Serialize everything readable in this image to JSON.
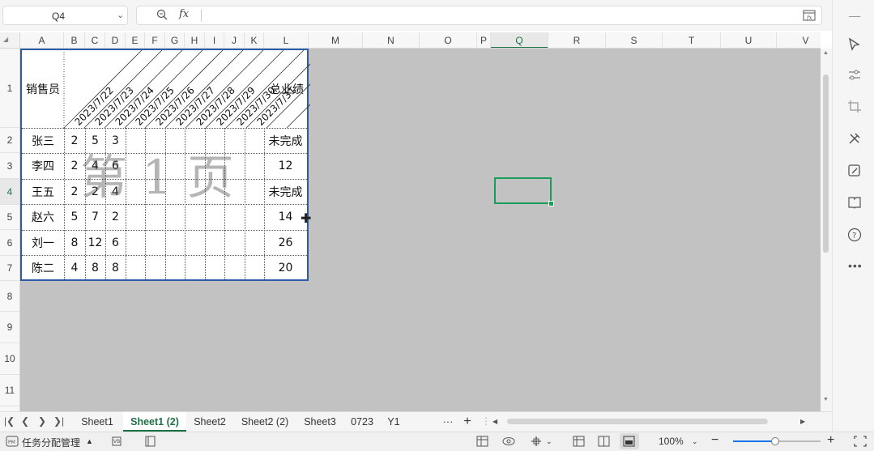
{
  "name_box": {
    "value": "Q4"
  },
  "formula_bar": {
    "fx_label": "fx",
    "value": ""
  },
  "columns": [
    {
      "label": "A"
    },
    {
      "label": "B"
    },
    {
      "label": "C"
    },
    {
      "label": "D"
    },
    {
      "label": "E"
    },
    {
      "label": "F"
    },
    {
      "label": "G"
    },
    {
      "label": "H"
    },
    {
      "label": "I"
    },
    {
      "label": "J"
    },
    {
      "label": "K"
    },
    {
      "label": "L"
    },
    {
      "label": "M"
    },
    {
      "label": "N"
    },
    {
      "label": "O"
    },
    {
      "label": "P"
    },
    {
      "label": "Q"
    },
    {
      "label": "R"
    },
    {
      "label": "S"
    },
    {
      "label": "T"
    },
    {
      "label": "U"
    },
    {
      "label": "V"
    }
  ],
  "rows": [
    "1",
    "2",
    "3",
    "4",
    "5",
    "6",
    "7",
    "8",
    "9",
    "10",
    "11"
  ],
  "selected_column": "Q",
  "selected_row": "4",
  "sheet": {
    "header_label": "销售员",
    "total_header": "总业绩",
    "date_headers": [
      "2023/7/22",
      "2023/7/23",
      "2023/7/24",
      "2023/7/25",
      "2023/7/26",
      "2023/7/27",
      "2023/7/28",
      "2023/7/29",
      "2023/7/30",
      "2023/7/31"
    ],
    "data_rows": [
      {
        "name": "张三",
        "b": "2",
        "c": "5",
        "d": "3",
        "total": "未完成"
      },
      {
        "name": "李四",
        "b": "2",
        "c": "4",
        "d": "6",
        "total": "12"
      },
      {
        "name": "王五",
        "b": "2",
        "c": "2",
        "d": "4",
        "total": "未完成"
      },
      {
        "name": "赵六",
        "b": "5",
        "c": "7",
        "d": "2",
        "total": "14"
      },
      {
        "name": "刘一",
        "b": "8",
        "c": "12",
        "d": "6",
        "total": "26"
      },
      {
        "name": "陈二",
        "b": "4",
        "c": "8",
        "d": "8",
        "total": "20"
      }
    ],
    "page_watermark": "第 1 页"
  },
  "tabs": [
    {
      "label": "Sheet1"
    },
    {
      "label": "Sheet1 (2)",
      "active": true
    },
    {
      "label": "Sheet2"
    },
    {
      "label": "Sheet2 (2)"
    },
    {
      "label": "Sheet3"
    },
    {
      "label": "0723"
    },
    {
      "label": "Y1"
    }
  ],
  "tabs_more": "···",
  "add_sheet": "+",
  "status": {
    "task_label": "任务分配管理",
    "zoom": "100%",
    "zoom_level_percent": 100
  },
  "right_toolbar_icons": [
    "cursor-icon",
    "sliders-icon",
    "crop-icon",
    "tools-icon",
    "edit-sheet-icon",
    "book-icon",
    "help-icon",
    "more-icon"
  ]
}
